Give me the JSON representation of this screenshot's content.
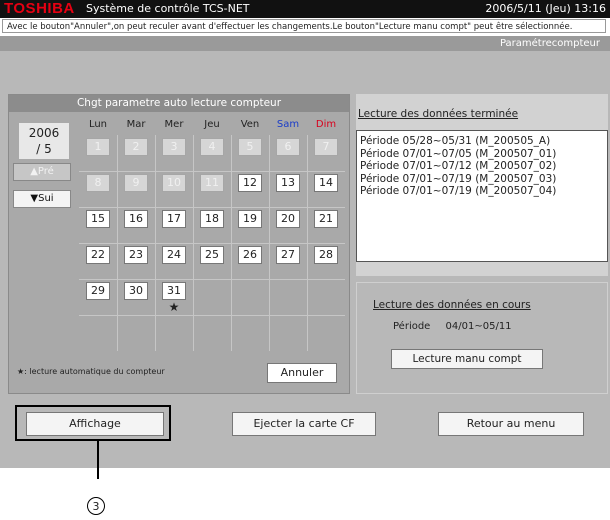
{
  "titlebar": {
    "brand": "TOSHIBA",
    "app_title": "Système de contrôle TCS-NET",
    "datetime": "2006/5/11 (Jeu)  13:16"
  },
  "infobar": {
    "text": "Avec le bouton\"Annuler\",on peut reculer avant d'effectuer les changements.Le bouton\"Lecture manu compt\" peut être sélectionnée."
  },
  "screen": {
    "subtitle": "Paramétrecompteur"
  },
  "calendar": {
    "title": "Chgt parametre auto lecture compteur",
    "year": "2006",
    "month": "/ 5",
    "prev_label": "▲Pré",
    "next_label": "▼Sui",
    "weekdays": [
      "Lun",
      "Mar",
      "Mer",
      "Jeu",
      "Ven",
      "Sam",
      "Dim"
    ],
    "weekday_colors": [
      "#222222",
      "#222222",
      "#222222",
      "#222222",
      "#222222",
      "#1a3cc8",
      "#d8001c"
    ],
    "rows": [
      [
        "1",
        "2",
        "3",
        "4",
        "5",
        "6",
        "7"
      ],
      [
        "8",
        "9",
        "10",
        "11",
        "12",
        "13",
        "14"
      ],
      [
        "15",
        "16",
        "17",
        "18",
        "19",
        "20",
        "21"
      ],
      [
        "22",
        "23",
        "24",
        "25",
        "26",
        "27",
        "28"
      ],
      [
        "29",
        "30",
        "31",
        "",
        "",
        "",
        ""
      ],
      [
        "",
        "",
        "",
        "",
        "",
        "",
        ""
      ]
    ],
    "disabled_days": [
      "1",
      "2",
      "3",
      "4",
      "5",
      "6",
      "7",
      "8",
      "9",
      "10",
      "11"
    ],
    "marked_day": "31",
    "star_symbol": "★",
    "legend": "★: lecture automatique du compteur",
    "annuler_label": "Annuler"
  },
  "read_done": {
    "title": "Lecture des données terminée",
    "periods": [
      "Période 05/28~05/31 (M_200505_A)",
      "Période 07/01~07/05 (M_200507_01)",
      "Période 07/01~07/12 (M_200507_02)",
      "Période 07/01~07/19 (M_200507_03)",
      "Période 07/01~07/19 (M_200507_04)"
    ]
  },
  "read_current": {
    "title": "Lecture des données en cours",
    "period_label": "Période",
    "period_value": "04/01~05/11",
    "manual_button": "Lecture manu compt"
  },
  "bottom": {
    "affichage": "Affichage",
    "ejecter": "Ejecter la carte CF",
    "retour": "Retour au menu"
  },
  "callout": {
    "number": "3"
  }
}
